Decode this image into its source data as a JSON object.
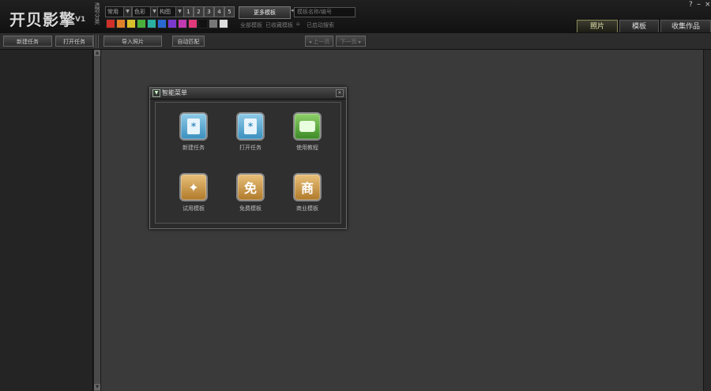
{
  "app": {
    "logo_text": "开贝影擎",
    "version": "V1"
  },
  "toolbar": {
    "side_label": "选项分类",
    "selects": [
      "常用",
      "色彩",
      "构图"
    ],
    "number_buttons": [
      "1",
      "2",
      "3",
      "4",
      "5"
    ],
    "swatches": [
      "#d0302a",
      "#e0822a",
      "#d8c02a",
      "#4ab03a",
      "#2ab0a0",
      "#2a6ad0",
      "#7a3ad0",
      "#c03ab0",
      "#e03a7a",
      "#111111",
      "#777777",
      "#dddddd"
    ],
    "more_button": "更多模板",
    "search_placeholder": "模板名称/编号",
    "sub_options": [
      "全部模板",
      "已收藏模板"
    ],
    "auto_search": "已启动搜索"
  },
  "tabs": [
    "照片",
    "模板",
    "收集作品"
  ],
  "window_controls": {
    "help": "?",
    "minimize": "–",
    "close": "×"
  },
  "toolbar2": {
    "new_task": "新建任务",
    "open_task": "打开任务",
    "import_photo": "导入照片",
    "smart_layout": "自动匹配",
    "prev": "◂ 上一页",
    "next": "下一页 ▸"
  },
  "dialog": {
    "title": "智能菜单",
    "close": "×",
    "apps": [
      {
        "label": "新建任务",
        "glyph": "*",
        "color": "blue"
      },
      {
        "label": "打开任务",
        "glyph": "*",
        "color": "blue"
      },
      {
        "label": "使用教程",
        "glyph": "",
        "color": "green"
      },
      {
        "label": "试用模板",
        "glyph": "✦",
        "color": "gold"
      },
      {
        "label": "免费模板",
        "glyph": "免",
        "color": "gold"
      },
      {
        "label": "商业模板",
        "glyph": "商",
        "color": "gold"
      }
    ]
  }
}
